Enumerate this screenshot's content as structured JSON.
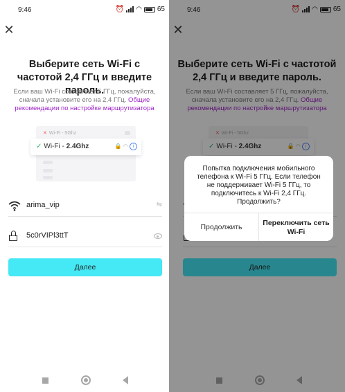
{
  "status": {
    "time": "9:46",
    "battery": "65"
  },
  "screen": {
    "title": "Выберите сеть Wi-Fi с частотой 2,4 ГГц и введите пароль.",
    "description": "Если ваш Wi-Fi составляет 5 ГГц, пожалуйста, сначала установите его на 2,4 ГГц.",
    "link": "Общие рекомендации по настройке маршрутизатора",
    "illustration": {
      "row_5ghz_prefix": "Wi-Fi - ",
      "row_5ghz_band": "5Ghz",
      "row_24_prefix": "Wi-Fi - ",
      "row_24_band": "2.4Ghz"
    },
    "ssid_value": "arima_vip",
    "password_value": "5c0rVIPl3ttT",
    "next_button": "Далее"
  },
  "dialog": {
    "message": "Попытка подключения мобильного телефона к Wi-Fi 5 ГГц. Если телефон не поддерживает Wi-Fi 5 ГГц, то подключитесь к Wi-Fi 2,4 ГГц. Продолжить?",
    "continue_button": "Продолжить",
    "switch_button": "Переключить сеть Wi-Fi"
  },
  "icons": {
    "close": "close-icon",
    "wifi": "wifi-icon",
    "lock": "lock-icon",
    "eye": "eye-icon",
    "switch": "switch-icon"
  },
  "colors": {
    "accent": "#45e8f5",
    "link": "#a025c9",
    "check": "#2ab36e"
  }
}
